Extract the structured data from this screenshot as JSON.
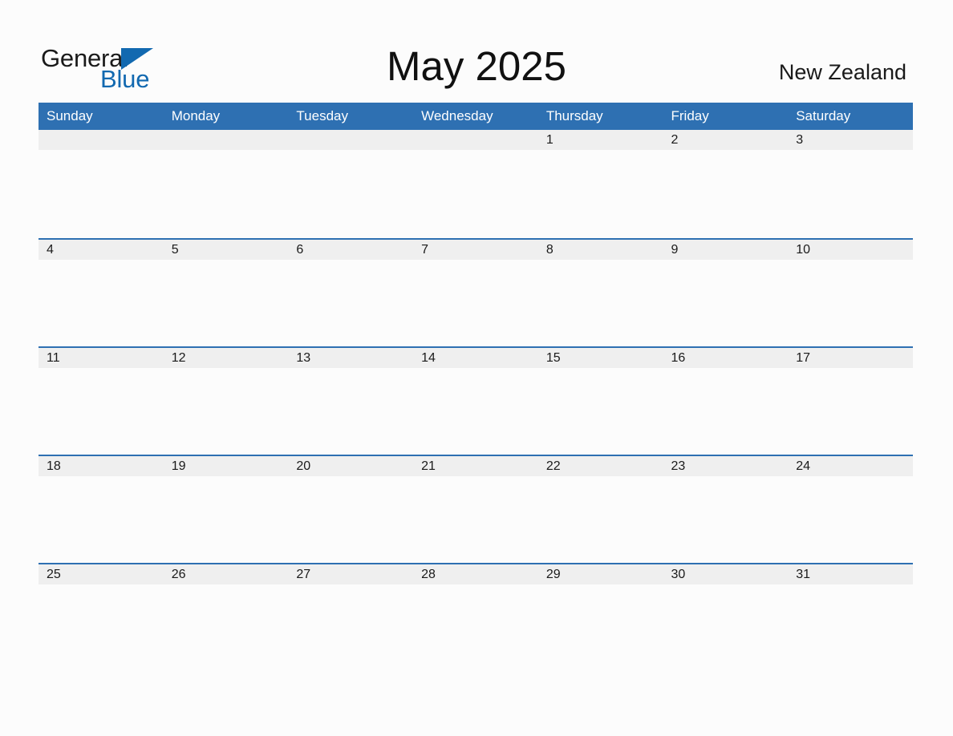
{
  "logo": {
    "text_primary": "General",
    "text_secondary": "Blue",
    "icon": "triangle-icon",
    "primary_color": "#1A1A1A",
    "secondary_color": "#1269B0"
  },
  "header": {
    "title": "May 2025",
    "country": "New Zealand"
  },
  "colors": {
    "header_blue": "#2E70B2",
    "rule_blue": "#2E70B2",
    "date_band_gray": "#EFEFEF",
    "page_background": "#FCFCFC",
    "text_dark": "#1A1A1A",
    "header_text": "#FFFFFF"
  },
  "calendar": {
    "weekdays": [
      "Sunday",
      "Monday",
      "Tuesday",
      "Wednesday",
      "Thursday",
      "Friday",
      "Saturday"
    ],
    "weeks": [
      {
        "days": [
          {
            "label": "",
            "empty": true
          },
          {
            "label": "",
            "empty": true
          },
          {
            "label": "",
            "empty": true
          },
          {
            "label": "",
            "empty": true
          },
          {
            "label": "1",
            "empty": false
          },
          {
            "label": "2",
            "empty": false
          },
          {
            "label": "3",
            "empty": false
          }
        ]
      },
      {
        "days": [
          {
            "label": "4",
            "empty": false
          },
          {
            "label": "5",
            "empty": false
          },
          {
            "label": "6",
            "empty": false
          },
          {
            "label": "7",
            "empty": false
          },
          {
            "label": "8",
            "empty": false
          },
          {
            "label": "9",
            "empty": false
          },
          {
            "label": "10",
            "empty": false
          }
        ]
      },
      {
        "days": [
          {
            "label": "11",
            "empty": false
          },
          {
            "label": "12",
            "empty": false
          },
          {
            "label": "13",
            "empty": false
          },
          {
            "label": "14",
            "empty": false
          },
          {
            "label": "15",
            "empty": false
          },
          {
            "label": "16",
            "empty": false
          },
          {
            "label": "17",
            "empty": false
          }
        ]
      },
      {
        "days": [
          {
            "label": "18",
            "empty": false
          },
          {
            "label": "19",
            "empty": false
          },
          {
            "label": "20",
            "empty": false
          },
          {
            "label": "21",
            "empty": false
          },
          {
            "label": "22",
            "empty": false
          },
          {
            "label": "23",
            "empty": false
          },
          {
            "label": "24",
            "empty": false
          }
        ]
      },
      {
        "days": [
          {
            "label": "25",
            "empty": false
          },
          {
            "label": "26",
            "empty": false
          },
          {
            "label": "27",
            "empty": false
          },
          {
            "label": "28",
            "empty": false
          },
          {
            "label": "29",
            "empty": false
          },
          {
            "label": "30",
            "empty": false
          },
          {
            "label": "31",
            "empty": false
          }
        ]
      }
    ]
  }
}
